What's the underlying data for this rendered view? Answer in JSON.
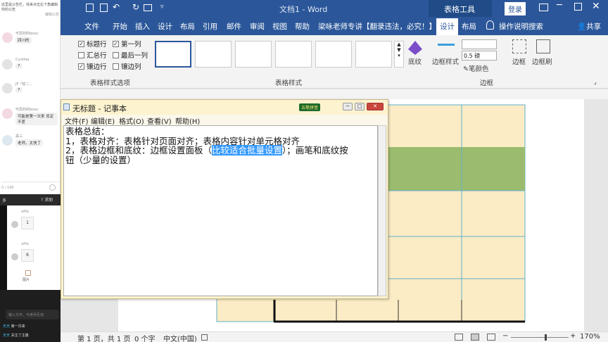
{
  "chat": {
    "notice": "这里是公告栏，快来点击右下角编辑你的公告",
    "notice_link": "编辑公告",
    "messages": [
      {
        "name": "可爱的的boss：",
        "text": "四川的"
      },
      {
        "name": "Cynthia",
        "text": "7"
      },
      {
        "name": "JF「晗二…",
        "text": "7"
      },
      {
        "name": "可爱的的boss：",
        "text": "可能是第一次来 肯定不差"
      },
      {
        "name": "黑三.",
        "text": "老师，太快了"
      }
    ],
    "counter": "0 / 140",
    "dark": {
      "bar_label": "多",
      "help": "求助",
      "answers": [
        {
          "name": "affie",
          "value": "1"
        },
        {
          "name": "affie",
          "value": "6"
        }
      ],
      "image_label": "图片",
      "text_input_placeholder": "输入文字，与老师互动",
      "danmaku": [
        {
          "tag": "天天",
          "text": "第一次来"
        },
        {
          "tag": "天天",
          "text": "关注了主播"
        }
      ]
    }
  },
  "word": {
    "title": "文档1 - Word",
    "context_tab": "表格工具",
    "login": "登录",
    "tabs": [
      "文件",
      "开始",
      "插入",
      "设计",
      "布局",
      "引用",
      "邮件",
      "审阅",
      "视图",
      "帮助",
      "梁咏老师专讲【翻录违法，必究！】",
      "设计",
      "布局"
    ],
    "help_search": "操作说明搜索",
    "share": "共享",
    "table_style_options": {
      "items": [
        {
          "label": "标题行",
          "checked": true
        },
        {
          "label": "第一列",
          "checked": true
        },
        {
          "label": "汇总行",
          "checked": false
        },
        {
          "label": "最后一列",
          "checked": false
        },
        {
          "label": "镶边行",
          "checked": true
        },
        {
          "label": "镶边列",
          "checked": false
        }
      ],
      "group_label": "表格样式选项"
    },
    "table_styles_label": "表格样式",
    "shading_label": "底纹",
    "border_styles_label": "边框样式",
    "pen_weight": "0.5 磅",
    "pen_color": "笔颜色",
    "borders_label": "边框",
    "border_painter": "边框刷",
    "borders_group": "边框",
    "status": {
      "page": "第 1 页，共 1 页",
      "words": "0 个字",
      "lang": "中文(中国)",
      "zoom": "170%"
    },
    "accent": "#2b579a"
  },
  "notepad": {
    "title": "无标题 - 记事本",
    "ime_badge": "五笔拼音",
    "menu": [
      "文件(F)",
      "编辑(E)",
      "格式(O)",
      "查看(V)",
      "帮助(H)"
    ],
    "line1": "表格总结：",
    "line2": "1，表格对齐：表格针对页面对齐；表格内容针对单元格对齐",
    "line3_pre": "2，表格边框和底纹：边框设置面板（",
    "line3_sel": "比较适合批量设置",
    "line3_post": "）；画笔和底纹按",
    "line4": "钮（少量的设置）"
  }
}
